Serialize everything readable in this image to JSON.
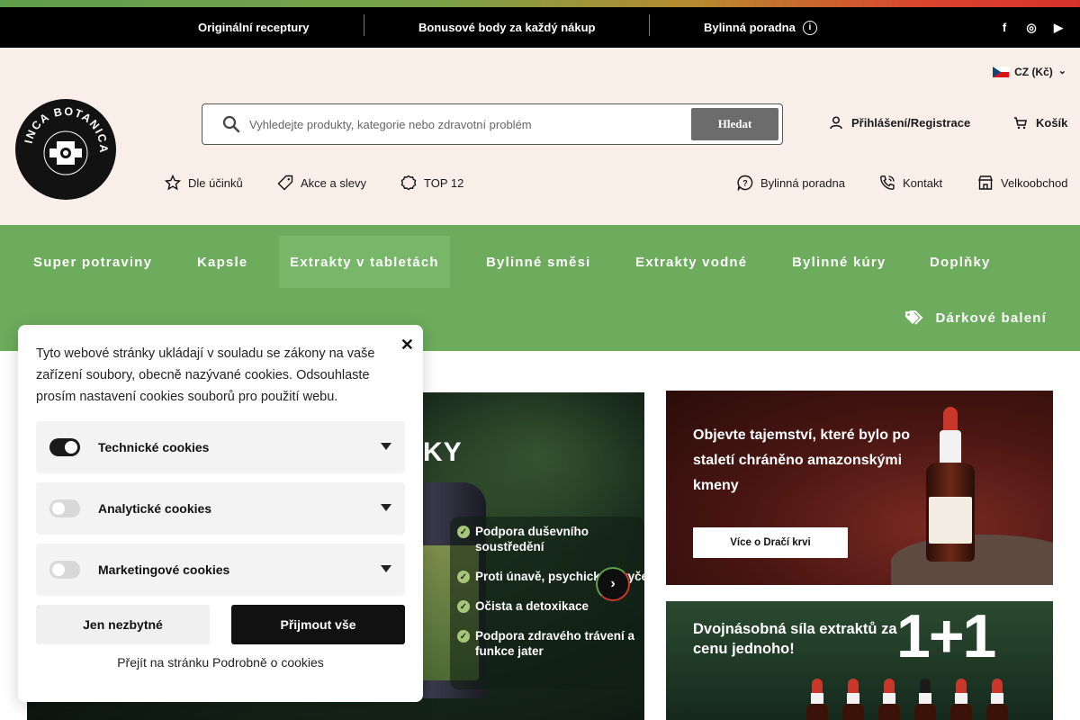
{
  "topbar": {
    "item1": "Originální receptury",
    "item2": "Bonusové body za každý nákup",
    "item3": "Bylinná poradna",
    "info_icon": "i",
    "social": [
      "f",
      "◎",
      "▶"
    ]
  },
  "header": {
    "lang": "CZ (Kč)",
    "lang_chevron": "⌄",
    "logo_alt": "INCA BOTANICA",
    "search_placeholder": "Vyhledejte produkty, kategorie nebo zdravotní problém",
    "search_button": "Hledat",
    "login": "Přihlášení/Registrace",
    "cart": "Košík",
    "subnav_left": [
      "Dle účinků",
      "Akce a slevy",
      "TOP 12"
    ],
    "subnav_right": [
      "Bylinná poradna",
      "Kontakt",
      "Velkoobchod"
    ]
  },
  "category_nav": {
    "items": [
      "Super potraviny",
      "Kapsle",
      "Extrakty v tabletách",
      "Bylinné směsi",
      "Extrakty vodné",
      "Bylinné kúry",
      "Doplňky"
    ],
    "active_index": 2,
    "gift": "Dárkové balení"
  },
  "hero": {
    "title_fragment": "KY",
    "benefits": [
      "Podpora duševního soustředění",
      "Proti únavě, psychickém vyčerpá",
      "Očista a detoxikace",
      "Podpora zdravého trávení a funkce jater"
    ],
    "check_icon": "✓",
    "next_arrow": "›"
  },
  "banner1": {
    "text": "Objevte tajemství, které bylo po staletí chráněno amazonskými kmeny",
    "cta": "Více o Dračí krvi"
  },
  "banner2": {
    "text": "Dvojnásobná síla extraktů za cenu jednoho!",
    "big": "1+1"
  },
  "cookie": {
    "close": "✕",
    "message": "Tyto webové stránky ukládají v souladu se zákony na vaše zařízení soubory, obecně nazývané cookies. Odsouhlaste prosím nastavení cookies souborů pro použití webu.",
    "categories": [
      {
        "name": "Technické cookies",
        "enabled": true
      },
      {
        "name": "Analytické cookies",
        "enabled": false
      },
      {
        "name": "Marketingové cookies",
        "enabled": false
      }
    ],
    "deny": "Jen nezbytné",
    "accept": "Přijmout vše",
    "link": "Přejít na stránku Podrobně o cookies"
  },
  "colors": {
    "green_nav": "#6cac5c",
    "header_bg": "#f9efe8",
    "topbar_bg": "#000000"
  }
}
